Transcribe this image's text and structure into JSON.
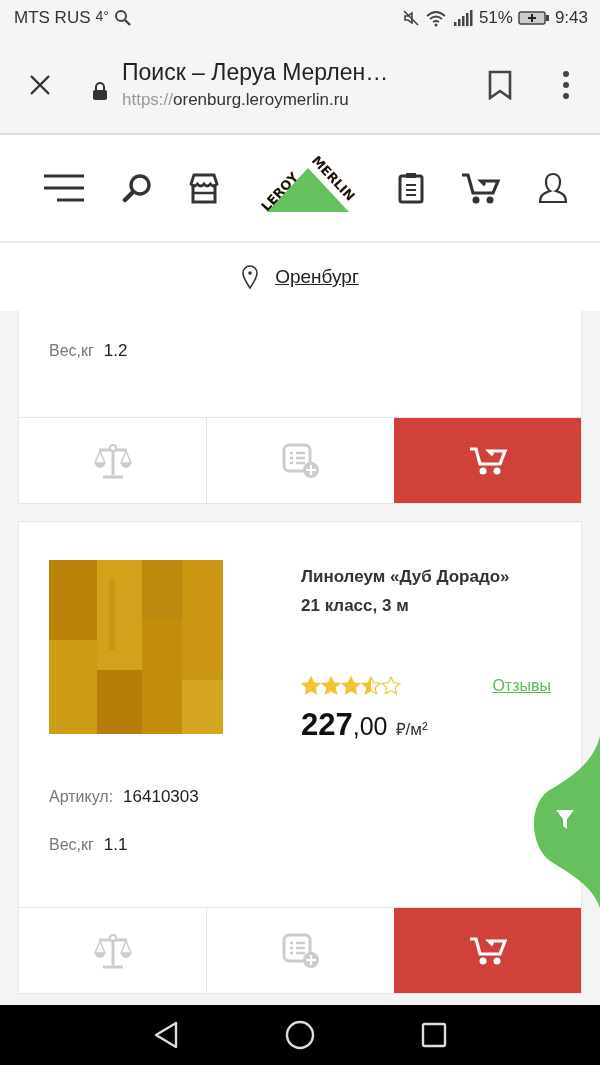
{
  "status_bar": {
    "carrier": "MTS RUS",
    "network": "4°",
    "battery": "51%",
    "time": "9:43"
  },
  "browser": {
    "title": "Поиск – Леруа Мерлен…",
    "url_scheme": "https://",
    "url_host": "orenburg.leroymerlin.ru"
  },
  "header": {
    "logo_left": "LEROY",
    "logo_right": "MERLIN"
  },
  "location": {
    "city": "Оренбург"
  },
  "products": [
    {
      "partial": true,
      "weight_label": "Вес,кг",
      "weight": "1.2"
    },
    {
      "partial": false,
      "name": "Линолеум «Дуб Дорадо» 21 класс, 3 м",
      "stars": 3.5,
      "reviews": "Отзывы",
      "price_int": "227",
      "price_frac": ",00",
      "unit": "₽/м²",
      "sku_label": "Артикул:",
      "sku": "16410303",
      "weight_label": "Вес,кг",
      "weight": "1.1"
    }
  ]
}
